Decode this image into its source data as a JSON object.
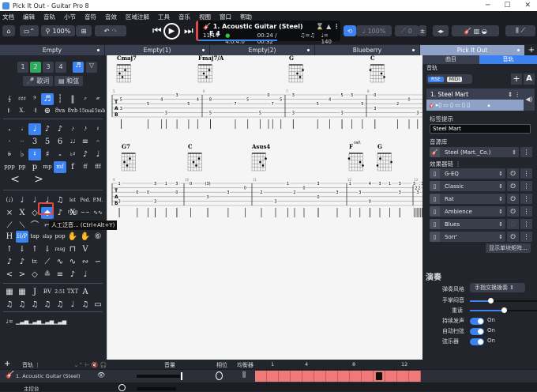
{
  "window": {
    "title": "Pick It Out - Guitar Pro 8",
    "min": "─",
    "max": "☐",
    "close": "✕"
  },
  "menu": [
    "文档",
    "编辑",
    "音轨",
    "小节",
    "音符",
    "音效",
    "区域注解",
    "工具",
    "音乐",
    "视图",
    "窗口",
    "帮助"
  ],
  "toolbar": {
    "zoom": "100%",
    "tempo_pct": "100%",
    "pitch": "0",
    "lcd": {
      "track": "1. Acoustic Guitar (Steel)",
      "bar": "11/14",
      "sig": "4.0:4.0",
      "time": "00:24 / 00:32",
      "swing": "♫=♫",
      "tempo": "♩= 140",
      "key": "E 4"
    }
  },
  "tabs": [
    {
      "label": "Empty"
    },
    {
      "label": "Empty(1)"
    },
    {
      "label": "Empty(2)"
    },
    {
      "label": "Blueberry"
    },
    {
      "label": "Pick It Out",
      "active": true
    }
  ],
  "left": {
    "voices": [
      "1",
      "2",
      "3",
      "4"
    ],
    "lyrics_btn": "歌词",
    "chord_btn": "和弦",
    "tooltip": "人工泛音... (Ctrl+Alt+Y)",
    "rows": [
      [
        "𝄞",
        "♯♯♯",
        "𝄢",
        "♬",
        "┆",
        "‖",
        "𝄎",
        "𝄏"
      ],
      [
        "𝄆",
        "X.",
        "𝄇",
        "⊕",
        "8va",
        "8vb",
        "15ma",
        "15mb"
      ],
      [
        "𝅝",
        "𝅗𝅥",
        "♩",
        "♪",
        "♪",
        "𝅘𝅥𝅯",
        "𝅘𝅥𝅰",
        "𝄽"
      ],
      [
        "·",
        "··",
        "3",
        "5",
        "6",
        "♩♩",
        "≡",
        "𝄐"
      ],
      [
        "𝄫",
        "♭",
        "♮",
        "♯",
        "𝄪",
        "♭♯",
        "♪",
        "♩"
      ],
      [
        "ppp",
        "pp",
        "p",
        "mp",
        "mf",
        "f",
        "ff",
        "fff"
      ],
      [
        "<",
        ">"
      ],
      [
        "(♩)",
        "♩",
        "♩",
        "♩",
        "♫",
        "let ring",
        "Ped.",
        "P.M."
      ],
      [
        "×",
        "X",
        "◇",
        "◆",
        "♪",
        "X",
        "~~",
        "∿∿"
      ],
      [
        "⟋",
        "⟍",
        "⌒",
        "⌐"
      ],
      [
        "H",
        "H/P",
        "tap",
        "slap",
        "pop",
        "✋",
        "✋",
        "⑥"
      ],
      [
        "↑",
        "↓",
        "↑",
        "↓",
        "rasg",
        "⊓",
        "V"
      ],
      [
        "♪",
        "♪",
        "tr.",
        "⟋",
        "∿",
        "∿",
        "∾",
        "∽"
      ],
      [
        "<",
        ">",
        "◇",
        "≗",
        "≡",
        "♪",
        "♩"
      ],
      [
        "▦",
        "▦",
        "J",
        "BV",
        "2:51",
        "TXT",
        "A"
      ],
      [
        "♫",
        "♫",
        "♫",
        "♫",
        "♫",
        "♩",
        "♫",
        "▭"
      ],
      [
        "♩=",
        "▁▃▅",
        "▁▃▅",
        "▁▃▅",
        "▁▃▅"
      ]
    ]
  },
  "score": {
    "row1": {
      "chords": [
        "Cmaj7",
        "Fmaj7/A",
        "G",
        "C"
      ],
      "measures": [
        "5",
        "6",
        "7",
        "8"
      ]
    },
    "row2": {
      "chords": [
        "G7",
        "C",
        "Asus4",
        "F",
        "G"
      ],
      "measures": [
        "9",
        "10",
        "11",
        "12",
        "13"
      ],
      "annotation": "rall."
    },
    "notes1": [
      [
        [
          0.1,
          2,
          "5"
        ],
        [
          0.1,
          4,
          "3"
        ],
        [
          0.4,
          3,
          "5"
        ],
        [
          0.55,
          2,
          "4"
        ],
        [
          0.6,
          5,
          "3"
        ],
        [
          0.85,
          3,
          "5"
        ],
        [
          0.95,
          2,
          "4"
        ],
        [
          0.72,
          1,
          "3"
        ]
      ],
      [
        [
          0.1,
          2,
          "8"
        ],
        [
          0.1,
          5,
          "5"
        ],
        [
          0.4,
          3,
          "7"
        ],
        [
          0.55,
          2,
          "5"
        ],
        [
          0.7,
          5,
          "5"
        ],
        [
          0.85,
          3,
          "7"
        ],
        [
          0.95,
          2,
          "5"
        ],
        [
          0.8,
          1,
          "0"
        ]
      ],
      [
        [
          0.1,
          1,
          "3"
        ],
        [
          0.1,
          5,
          "3"
        ],
        [
          0.4,
          3,
          "5"
        ],
        [
          0.55,
          2,
          "4"
        ],
        [
          0.7,
          1,
          "5"
        ],
        [
          0.7,
          5,
          "3"
        ],
        [
          0.82,
          1,
          "3"
        ],
        [
          0.95,
          3,
          "5"
        ]
      ],
      [
        [
          0.15,
          1,
          "0"
        ],
        [
          0.15,
          4,
          "3"
        ],
        [
          0.55,
          3,
          "2"
        ],
        [
          0.75,
          2,
          "0"
        ],
        [
          0.9,
          5,
          "3"
        ]
      ]
    ],
    "notes2": [
      [
        [
          0.1,
          1,
          "1"
        ],
        [
          0.1,
          5,
          "3"
        ],
        [
          0.35,
          3,
          "0"
        ],
        [
          0.5,
          3,
          "0"
        ],
        [
          0.6,
          1,
          "3"
        ],
        [
          0.6,
          5,
          "3"
        ],
        [
          0.75,
          1,
          "1"
        ],
        [
          0.9,
          1,
          "3"
        ],
        [
          0.9,
          3,
          "0"
        ]
      ],
      [
        [
          0.1,
          1,
          "0"
        ],
        [
          0.35,
          1,
          "(3)"
        ],
        [
          0.35,
          4,
          "3"
        ],
        [
          0.65,
          3,
          "3"
        ],
        [
          0.9,
          2,
          "0"
        ]
      ],
      [
        [
          0.1,
          3,
          "2"
        ],
        [
          0.25,
          5,
          "3"
        ],
        [
          0.38,
          1,
          "1"
        ],
        [
          0.45,
          3,
          "2"
        ],
        [
          0.55,
          2,
          "0"
        ],
        [
          0.7,
          1,
          "3"
        ],
        [
          0.7,
          4,
          "0"
        ],
        [
          0.9,
          3,
          "3"
        ]
      ],
      [
        [
          0.05,
          1,
          "1"
        ],
        [
          0.2,
          3,
          "3"
        ],
        [
          0.35,
          1,
          "4"
        ],
        [
          0.35,
          5,
          "0"
        ],
        [
          0.5,
          1,
          "3"
        ],
        [
          0.65,
          1,
          "1"
        ],
        [
          0.8,
          1,
          "3"
        ],
        [
          0.8,
          3,
          "3"
        ]
      ],
      [
        [
          0.1,
          1,
          "3"
        ],
        [
          0.3,
          2,
          "2"
        ],
        [
          0.45,
          3,
          "3"
        ],
        [
          0.6,
          2,
          "2"
        ],
        [
          0.75,
          1,
          "3"
        ],
        [
          0.9,
          1,
          "3"
        ]
      ]
    ]
  },
  "right": {
    "tabs": [
      "曲目",
      "音轨"
    ],
    "section": "音轨",
    "rse": "RSE",
    "midi": "MIDI",
    "track": "1. Steel Mart",
    "label_title": "标签提示",
    "label_value": "Steel Mart",
    "bank_title": "音源库",
    "bank": "Steel (Mart._Co.)",
    "fx_title": "效果器链",
    "fx": [
      {
        "name": "G-EQ",
        "on": true
      },
      {
        "name": "Classic",
        "on": true
      },
      {
        "name": "Rat",
        "on": true
      },
      {
        "name": "Ambience",
        "on": true
      },
      {
        "name": "Blues",
        "on": false
      },
      {
        "name": "Sorr'",
        "on": true
      }
    ],
    "matrix_btn": "显示单块矩阵...",
    "perf_title": "演奏",
    "style_label": "弹奏风格",
    "style_value": "手指交换拨奏",
    "mute_label": "手掌闷音",
    "mute_value": 0.3,
    "accent_label": "重读",
    "accent_value": 0.5,
    "toggles": [
      {
        "label": "持续发声",
        "value": "On"
      },
      {
        "label": "自动扫弦",
        "value": "On"
      },
      {
        "label": "弦乐器",
        "value": "On"
      }
    ]
  },
  "bottom": {
    "tracks_label": "音轨",
    "volume_label": "音量",
    "pan_label": "相位",
    "eq_label": "均衡器",
    "bar_numbers": [
      "1",
      "4",
      "8",
      "12"
    ],
    "track": "1. Acoustic Guitar (Steel)",
    "master": "主控台",
    "bars": 14,
    "current_bar": 11
  }
}
